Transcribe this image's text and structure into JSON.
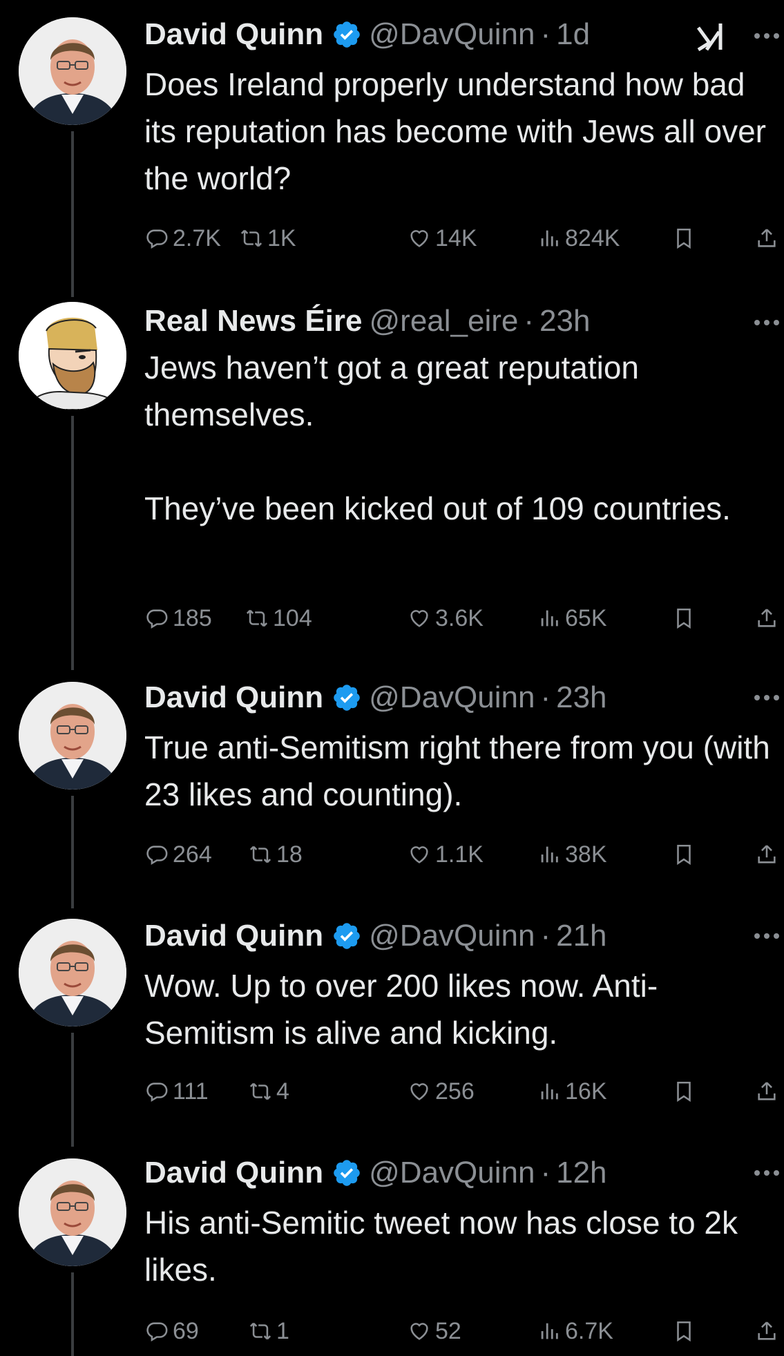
{
  "colors": {
    "background": "#000000",
    "text": "#e7e9ea",
    "secondary": "#8b8f94",
    "verified_blue": "#1d9bf0",
    "thread_line": "#3a3d40"
  },
  "tweets": [
    {
      "author": "David Quinn",
      "verified": true,
      "avatar_icon": "person-photo-icon",
      "handle": "@DavQuinn",
      "time": "1d",
      "text": "Does Ireland properly understand how bad its reputation has become with Jews all over the world?",
      "replies": "2.7K",
      "reposts": "1K",
      "likes": "14K",
      "views": "824K"
    },
    {
      "author": "Real News Éire",
      "verified": false,
      "avatar_icon": "cartoon-bearded-man-icon",
      "handle": "@real_eire",
      "time": "23h",
      "text": "Jews haven’t got a great reputation themselves.\n\nThey’ve been kicked out of 109 countries.",
      "replies": "185",
      "reposts": "104",
      "likes": "3.6K",
      "views": "65K"
    },
    {
      "author": "David Quinn",
      "verified": true,
      "avatar_icon": "person-photo-icon",
      "handle": "@DavQuinn",
      "time": "23h",
      "text": "True anti-Semitism right there from you (with 23 likes and counting).",
      "replies": "264",
      "reposts": "18",
      "likes": "1.1K",
      "views": "38K"
    },
    {
      "author": "David Quinn",
      "verified": true,
      "avatar_icon": "person-photo-icon",
      "handle": "@DavQuinn",
      "time": "21h",
      "text": "Wow. Up to over 200 likes now. Anti-Semitism is alive and kicking.",
      "replies": "111",
      "reposts": "4",
      "likes": "256",
      "views": "16K"
    },
    {
      "author": "David Quinn",
      "verified": true,
      "avatar_icon": "person-photo-icon",
      "handle": "@DavQuinn",
      "time": "12h",
      "text": "His anti-Semitic tweet now has close to 2k likes.",
      "replies": "69",
      "reposts": "1",
      "likes": "52",
      "views": "6.7K"
    }
  ],
  "separator": "·"
}
